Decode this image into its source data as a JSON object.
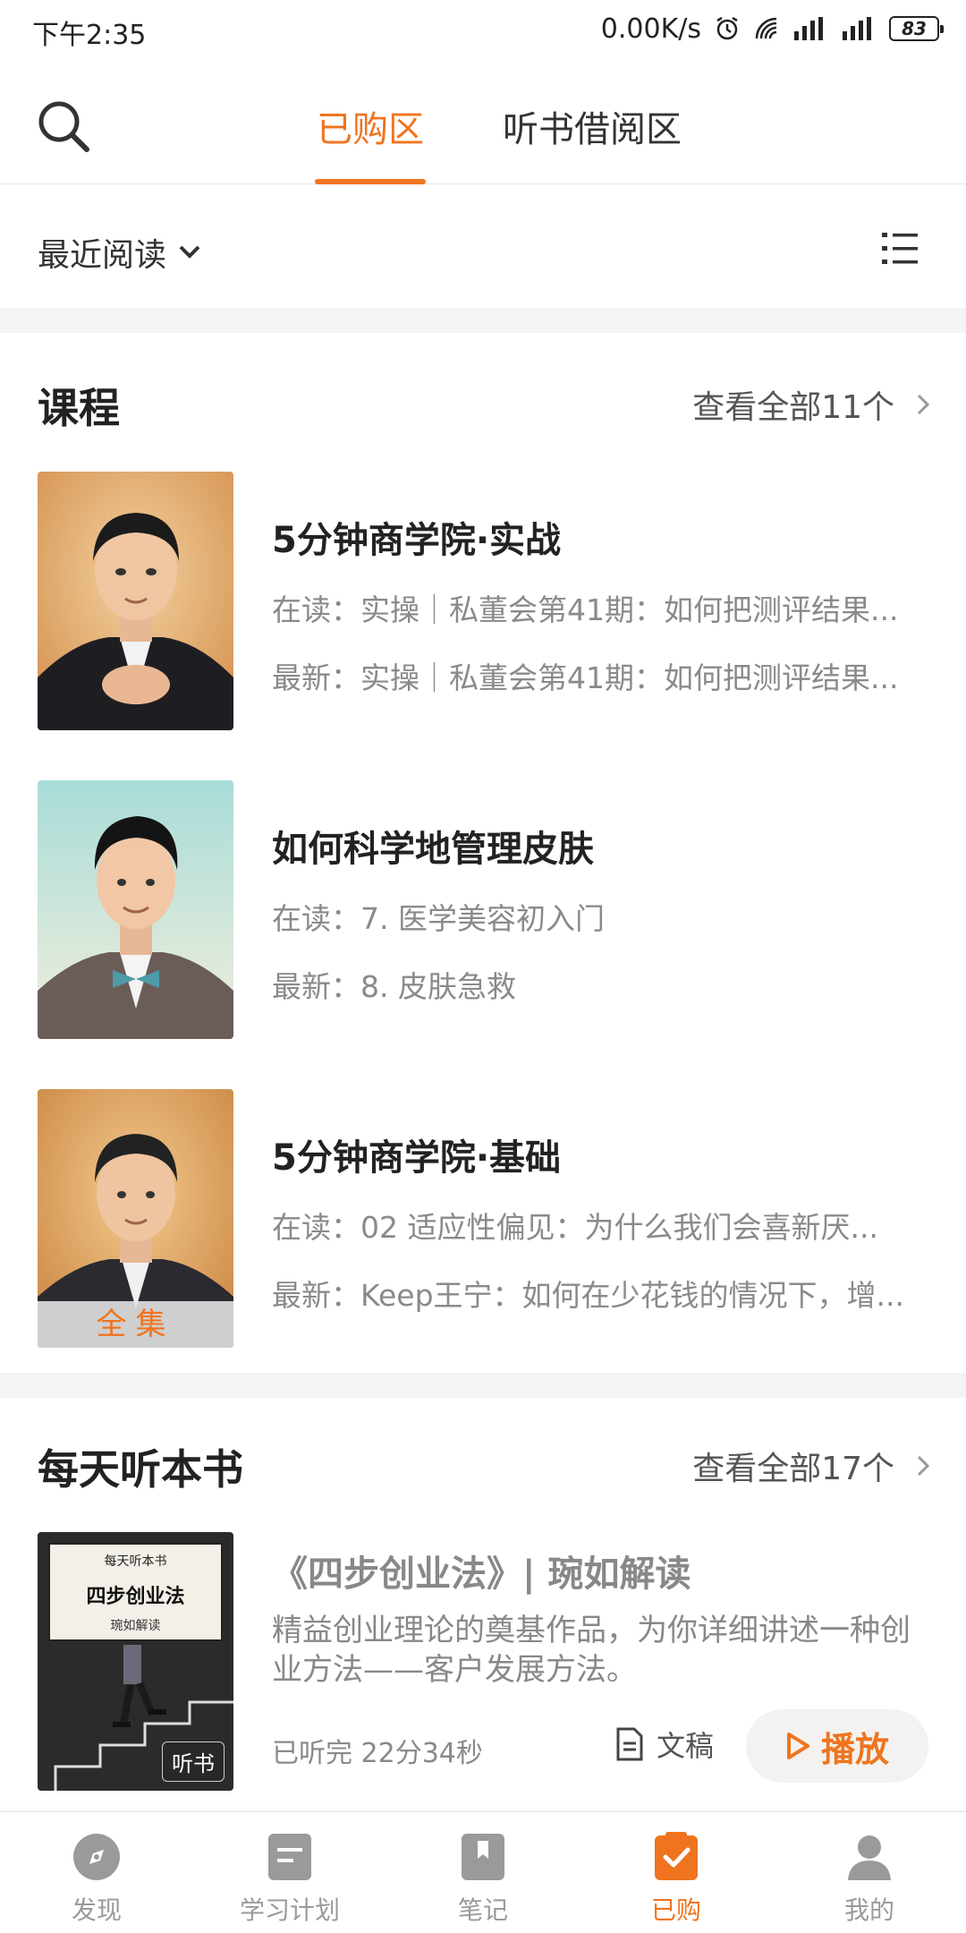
{
  "status_bar": {
    "time": "下午2:35",
    "net_speed": "0.00K/s",
    "battery": "83"
  },
  "top_nav": {
    "tabs": [
      {
        "label": "已购区",
        "active": true
      },
      {
        "label": "听书借阅区",
        "active": false
      }
    ]
  },
  "filter": {
    "sort_label": "最近阅读"
  },
  "courses": {
    "title": "课程",
    "view_all": "查看全部11个",
    "items": [
      {
        "title": "5分钟商学院·实战",
        "reading": "在读：实操｜私董会第41期：如何把测评结果...",
        "latest": "最新：实操｜私董会第41期：如何把测评结果..."
      },
      {
        "title": "如何科学地管理皮肤",
        "reading": "在读：7. 医学美容初入门",
        "latest": "最新：8. 皮肤急救"
      },
      {
        "title": "5分钟商学院·基础",
        "reading": "在读：02 适应性偏见：为什么我们会喜新厌...",
        "latest": "最新：Keep王宁：如何在少花钱的情况下，增...",
        "badge": "全集"
      }
    ]
  },
  "daily_book": {
    "title": "每天听本书",
    "view_all": "查看全部17个",
    "item": {
      "cover_header": "每天听本书",
      "cover_title": "四步创业法",
      "cover_subtitle": "琬如解读",
      "cover_badge": "听书",
      "title": "《四步创业法》| 琬如解读",
      "description": "精益创业理论的奠基作品，为你详细讲述一种创业方法——客户发展方法。",
      "status": "已听完 22分34秒",
      "manuscript_label": "文稿",
      "play_label": "播放"
    }
  },
  "bottom_nav": {
    "items": [
      {
        "label": "发现",
        "icon": "compass-icon"
      },
      {
        "label": "学习计划",
        "icon": "plan-icon"
      },
      {
        "label": "笔记",
        "icon": "bookmark-icon"
      },
      {
        "label": "已购",
        "icon": "check-icon",
        "active": true
      },
      {
        "label": "我的",
        "icon": "person-icon"
      }
    ]
  },
  "colors": {
    "accent": "#f0741f",
    "muted_text": "#8a8a8a",
    "divider": "#f4f4f4"
  }
}
